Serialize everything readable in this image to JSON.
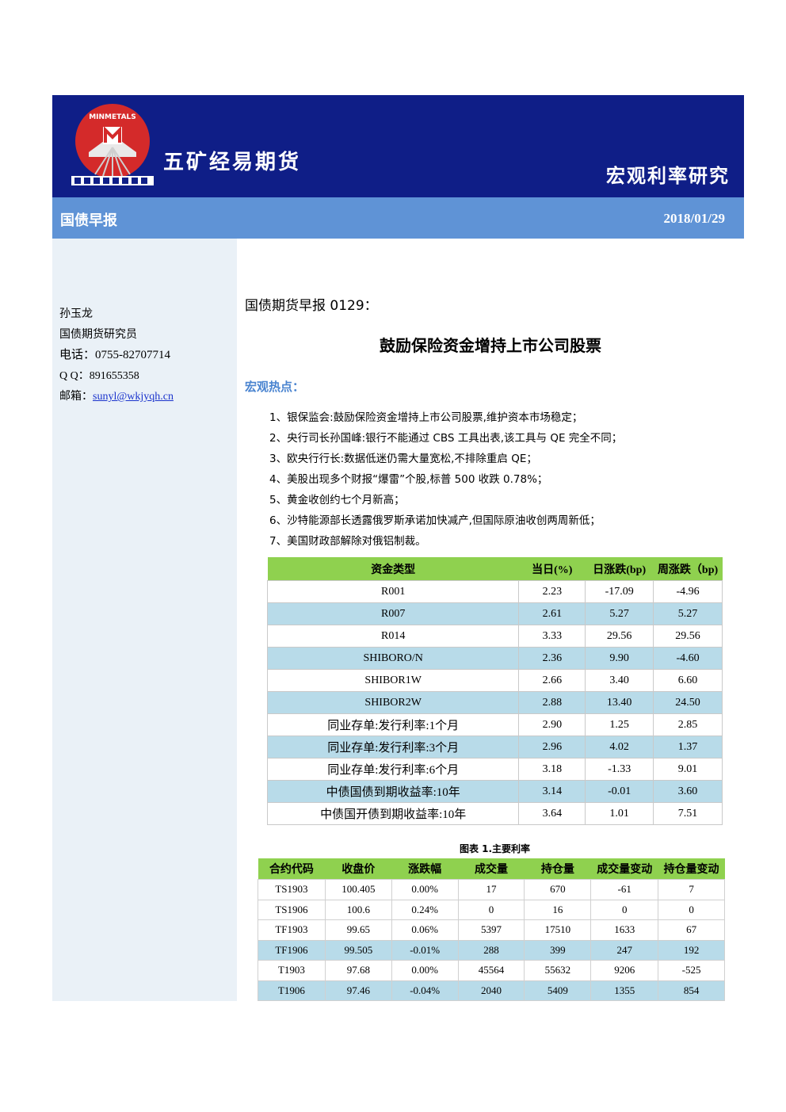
{
  "header": {
    "logo_text": "MINMETALS",
    "company": "五矿经易期货",
    "section_title": "宏观利率研究"
  },
  "subbar": {
    "report_type": "国债早报",
    "date": "2018/01/29"
  },
  "sidebar": {
    "name": "孙玉龙",
    "title": "国债期货研究员",
    "phone": "电话：0755-82707714",
    "qq": "Q Q：891655358",
    "email_label": "邮箱：",
    "email": "sunyl@wkjyqh.cn"
  },
  "main": {
    "doc_title": "国债期货早报 0129：",
    "headline": "鼓励保险资金增持上市公司股票",
    "hotspot_label": "宏观热点：",
    "news": [
      "1、银保监会:鼓励保险资金增持上市公司股票,维护资本市场稳定；",
      "2、央行司长孙国峰:银行不能通过 CBS 工具出表,该工具与 QE 完全不同；",
      "3、欧央行行长:数据低迷仍需大量宽松,不排除重启 QE；",
      "4、美股出现多个财报“爆雷”个股,标普 500 收跌 0.78%；",
      "5、黄金收创约七个月新高；",
      "6、沙特能源部长透露俄罗斯承诺加快减产,但国际原油收创两周新低；",
      "7、美国财政部解除对俄铝制裁。"
    ]
  },
  "rates_table": {
    "headers": [
      "资金类型",
      "当日(%)",
      "日涨跌(bp)",
      "周涨跌（bp)"
    ],
    "rows": [
      [
        "R001",
        "2.23",
        "-17.09",
        "-4.96"
      ],
      [
        "R007",
        "2.61",
        "5.27",
        "5.27"
      ],
      [
        "R014",
        "3.33",
        "29.56",
        "29.56"
      ],
      [
        "SHIBORO/N",
        "2.36",
        "9.90",
        "-4.60"
      ],
      [
        "SHIBOR1W",
        "2.66",
        "3.40",
        "6.60"
      ],
      [
        "SHIBOR2W",
        "2.88",
        "13.40",
        "24.50"
      ],
      [
        "同业存单:发行利率:1个月",
        "2.90",
        "1.25",
        "2.85"
      ],
      [
        "同业存单:发行利率:3个月",
        "2.96",
        "4.02",
        "1.37"
      ],
      [
        "同业存单:发行利率:6个月",
        "3.18",
        "-1.33",
        "9.01"
      ],
      [
        "中债国债到期收益率:10年",
        "3.14",
        "-0.01",
        "3.60"
      ],
      [
        "中债国开债到期收益率:10年",
        "3.64",
        "1.01",
        "7.51"
      ]
    ],
    "caption": "图表 1.主要利率"
  },
  "contracts_table": {
    "headers": [
      "合约代码",
      "收盘价",
      "涨跌幅",
      "成交量",
      "持仓量",
      "成交量变动",
      "持仓量变动"
    ],
    "rows": [
      [
        "TS1903",
        "100.405",
        "0.00%",
        "17",
        "670",
        "-61",
        "7"
      ],
      [
        "TS1906",
        "100.6",
        "0.24%",
        "0",
        "16",
        "0",
        "0"
      ],
      [
        "TF1903",
        "99.65",
        "0.06%",
        "5397",
        "17510",
        "1633",
        "67"
      ],
      [
        "TF1906",
        "99.505",
        "-0.01%",
        "288",
        "399",
        "247",
        "192"
      ],
      [
        "T1903",
        "97.68",
        "0.00%",
        "45564",
        "55632",
        "9206",
        "-525"
      ],
      [
        "T1906",
        "97.46",
        "-0.04%",
        "2040",
        "5409",
        "1355",
        "854"
      ]
    ]
  },
  "colors": {
    "header_bg": "#0f1e87",
    "subbar_bg": "#5f93d6",
    "sidebar_bg": "#eaf1f7",
    "table_header": "#8fd14f",
    "table_alt_row": "#b8dbe9",
    "hotspot_text": "#4a84d0"
  }
}
